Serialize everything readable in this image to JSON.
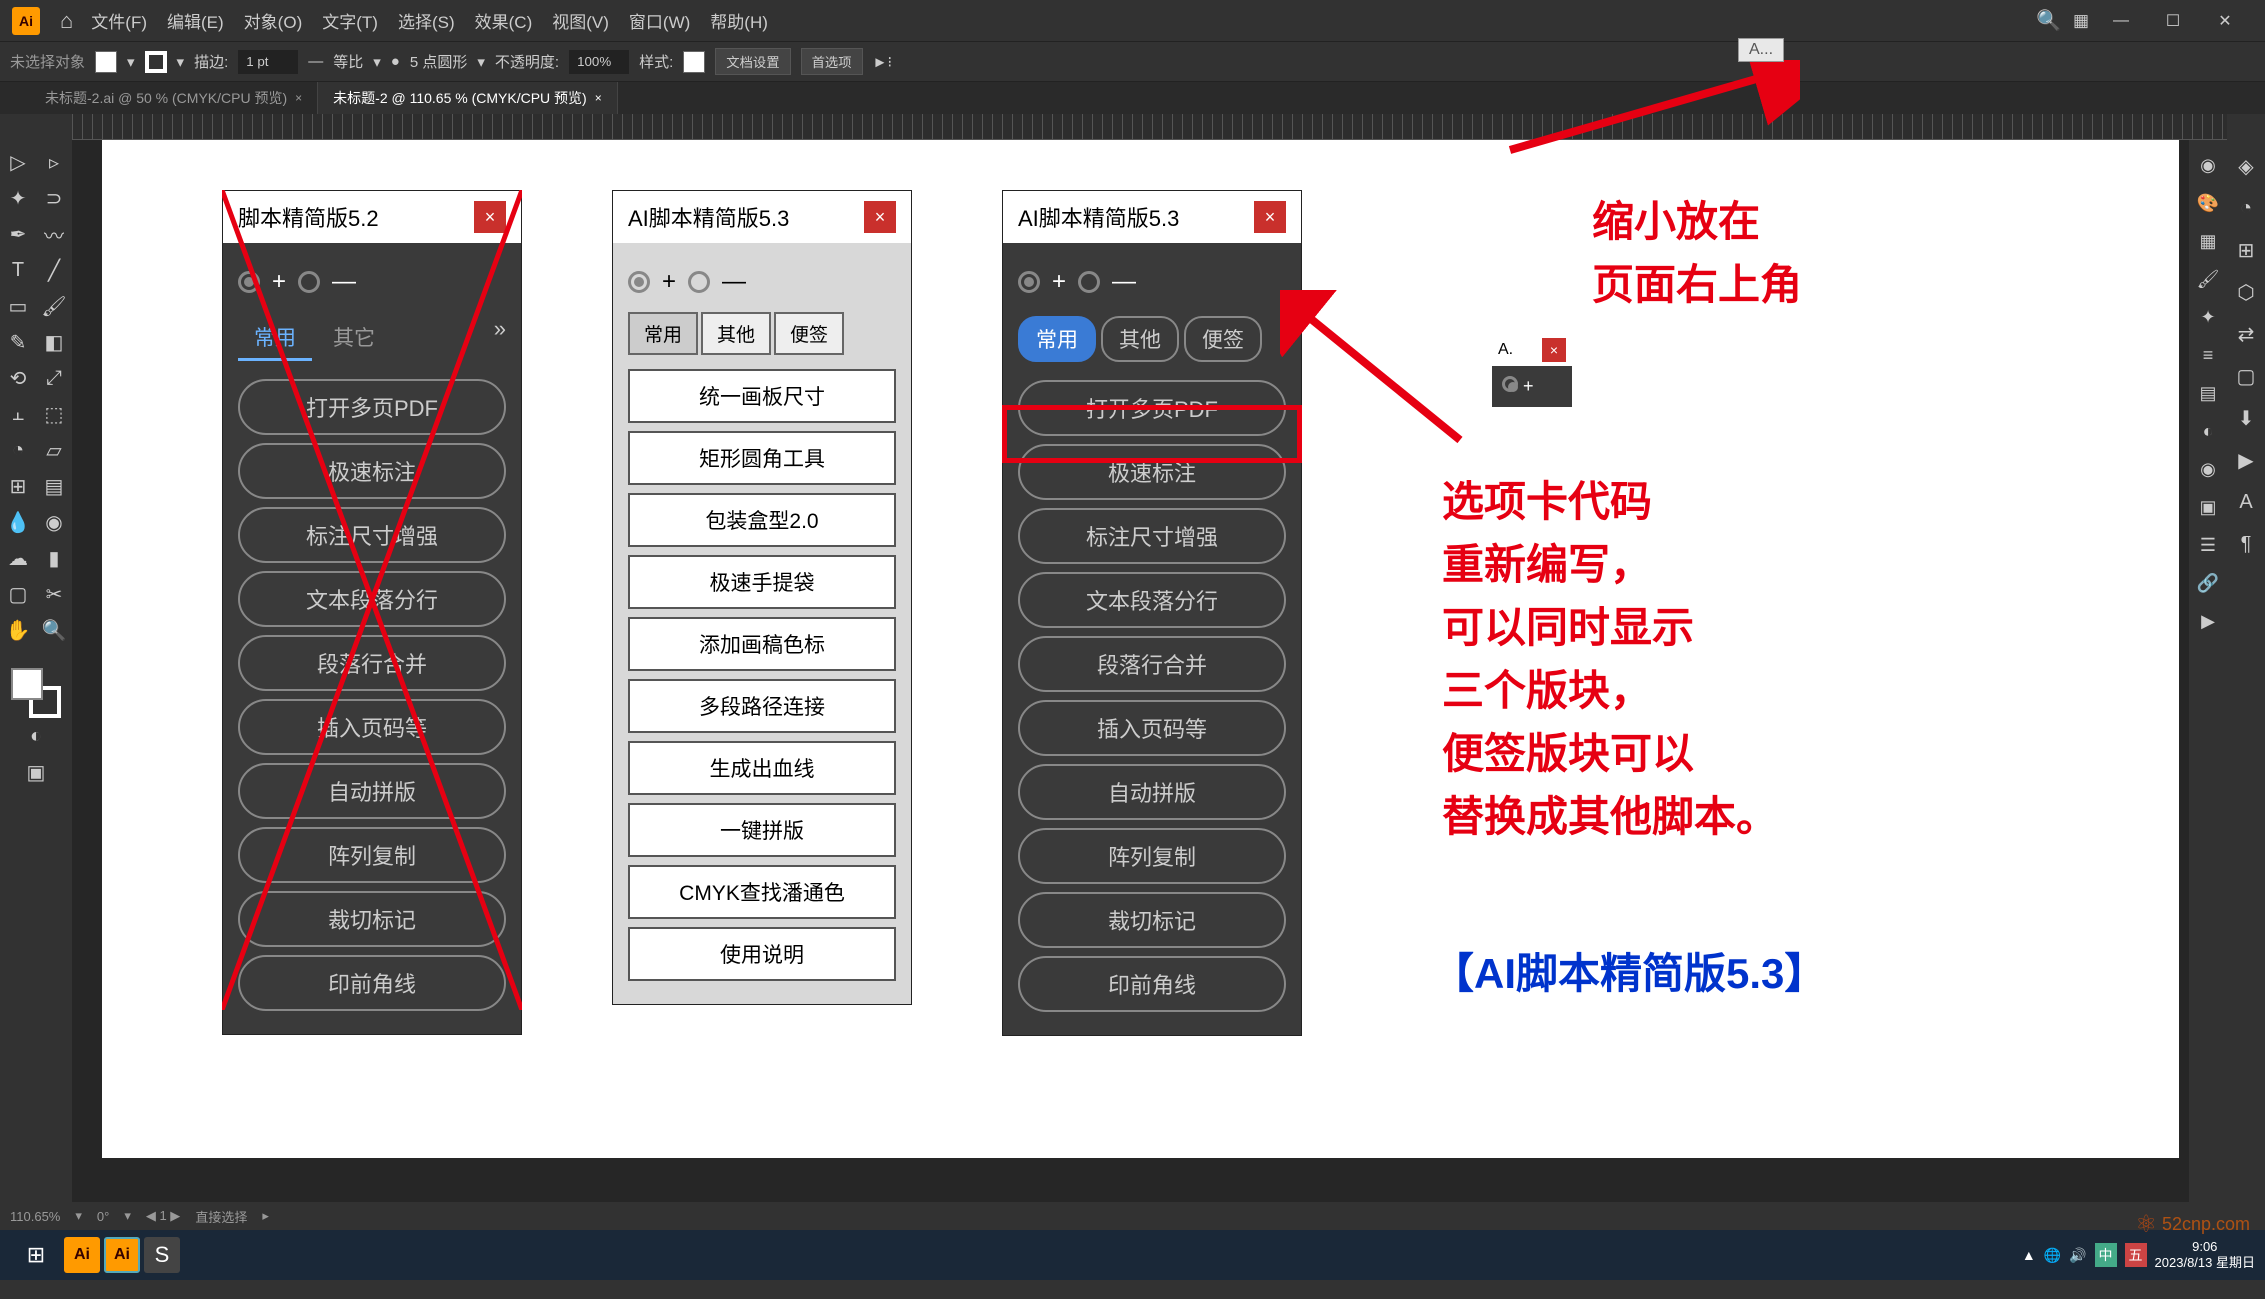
{
  "app": {
    "name": "Ai"
  },
  "menu": [
    "文件(F)",
    "编辑(E)",
    "对象(O)",
    "文字(T)",
    "选择(S)",
    "效果(C)",
    "视图(V)",
    "窗口(W)",
    "帮助(H)"
  ],
  "optbar": {
    "noSelection": "未选择对象",
    "stroke": "描边:",
    "strokeVal": "1 pt",
    "uniform": "等比",
    "pt5": "5 点圆形",
    "opacity": "不透明度:",
    "opacityVal": "100%",
    "style": "样式:",
    "docSetup": "文档设置",
    "prefs": "首选项"
  },
  "tabs": [
    {
      "label": "未标题-2.ai @ 50 % (CMYK/CPU 预览)",
      "active": false
    },
    {
      "label": "未标题-2 @ 110.65 % (CMYK/CPU 预览)",
      "active": true
    }
  ],
  "floatA": "A...",
  "panel52": {
    "title": "脚本精简版5.2",
    "tabs": [
      "常用",
      "其它"
    ],
    "buttons": [
      "打开多页PDF",
      "极速标注",
      "标注尺寸增强",
      "文本段落分行",
      "段落行合并",
      "插入页码等",
      "自动拼版",
      "阵列复制",
      "裁切标记",
      "印前角线"
    ]
  },
  "panel53light": {
    "title": "AI脚本精简版5.3",
    "tabs": [
      "常用",
      "其他",
      "便签"
    ],
    "buttons": [
      "统一画板尺寸",
      "矩形圆角工具",
      "包装盒型2.0",
      "极速手提袋",
      "添加画稿色标",
      "多段路径连接",
      "生成出血线",
      "一键拼版",
      "CMYK查找潘通色",
      "使用说明"
    ]
  },
  "panel53dark": {
    "title": "AI脚本精简版5.3",
    "tabs": [
      "常用",
      "其他",
      "便签"
    ],
    "buttons": [
      "打开多页PDF",
      "极速标注",
      "标注尺寸增强",
      "文本段落分行",
      "段落行合并",
      "插入页码等",
      "自动拼版",
      "阵列复制",
      "裁切标记",
      "印前角线"
    ]
  },
  "miniPanel": {
    "title": "A."
  },
  "annotations": {
    "topRight1": "缩小放在",
    "topRight2": "页面右上角",
    "mid": "选项卡代码\n重新编写，\n可以同时显示\n三个版块，\n便签版块可以\n替换成其他脚本。",
    "bottom": "【AI脚本精简版5.3】"
  },
  "status": {
    "zoom": "110.65%",
    "tool": "直接选择"
  },
  "taskbar": {
    "time": "9:06",
    "date": "2023/8/13 星期日",
    "lang": "中",
    "ime": "五"
  },
  "watermark": "52cnp.com"
}
